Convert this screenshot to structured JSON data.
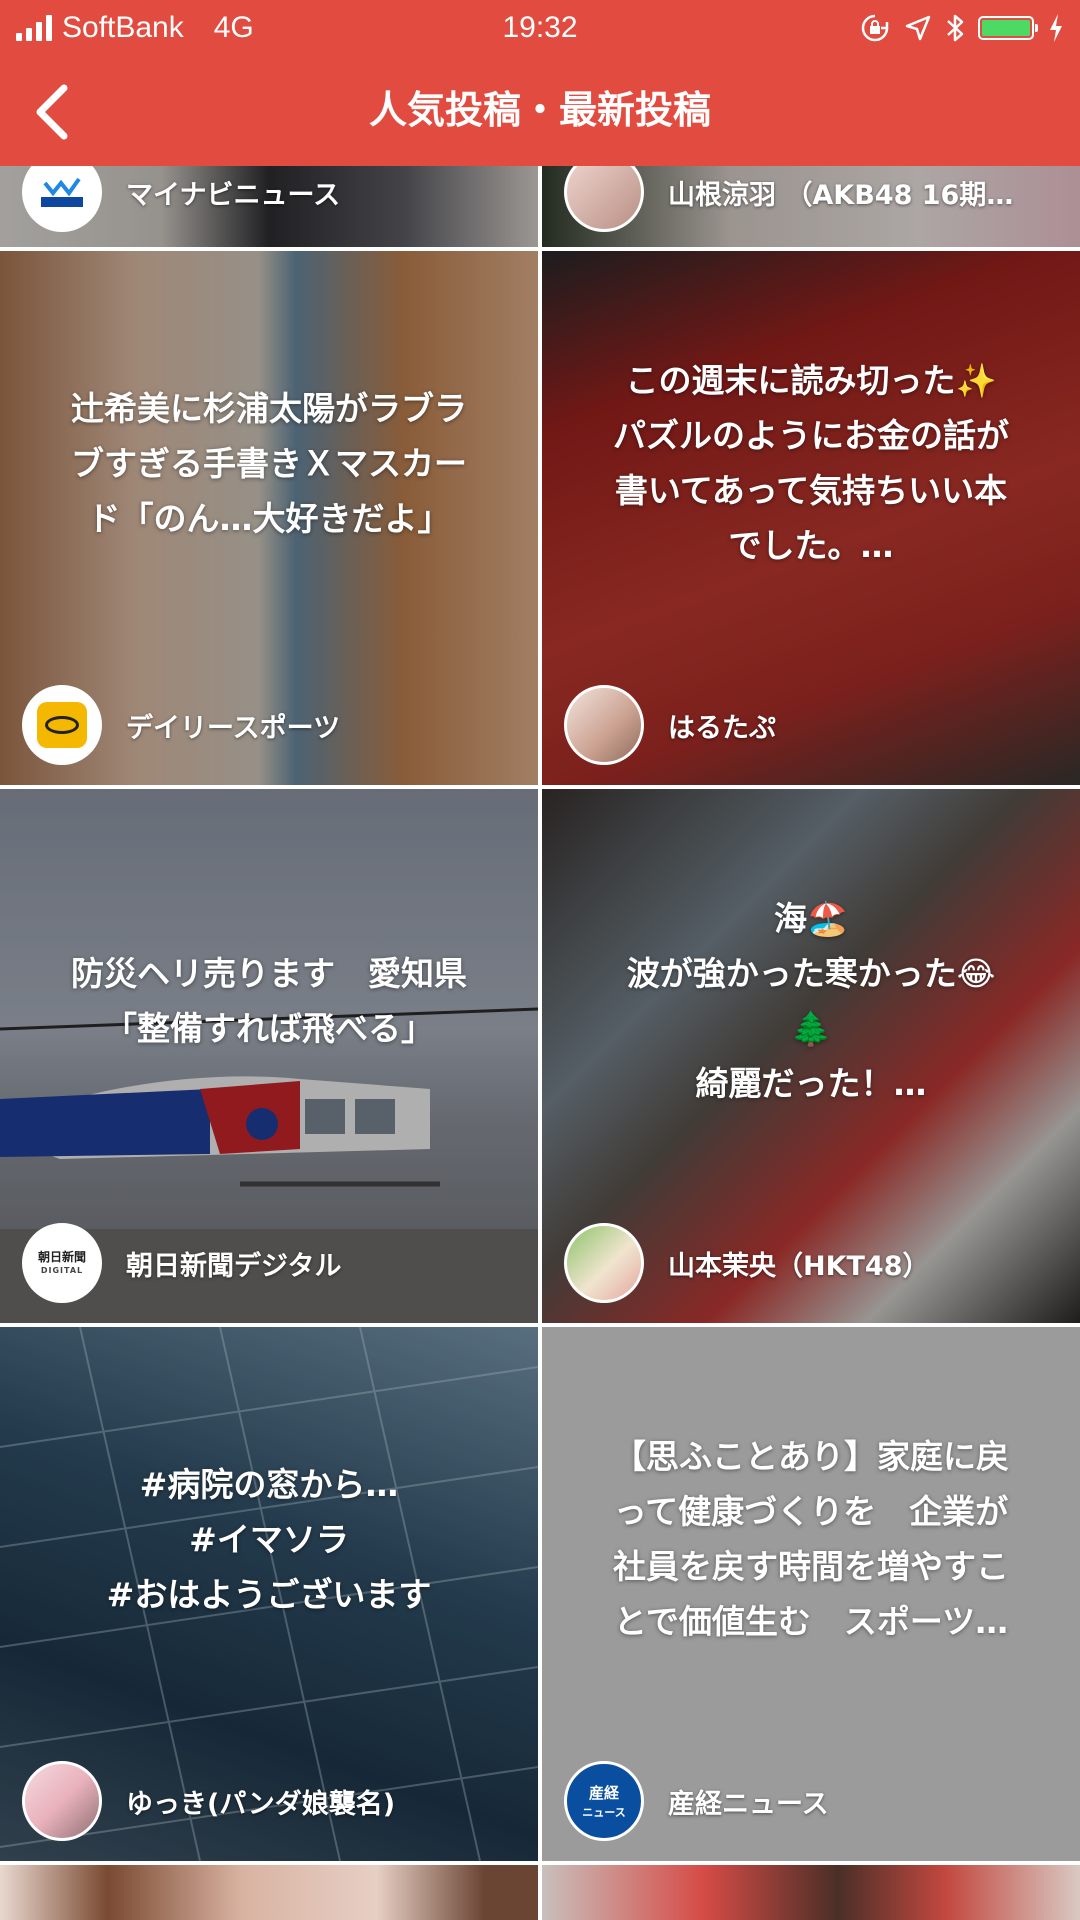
{
  "status": {
    "carrier": "SoftBank",
    "network": "4G",
    "time": "19:32",
    "battery_color": "#4cd964"
  },
  "header": {
    "title": "人気投稿・最新投稿",
    "back_icon": "chevron-left-icon",
    "background": "#e24b3f"
  },
  "top_partial": [
    {
      "author": "マイナビニュース"
    },
    {
      "author": "山根涼羽 （AKB48 16期…"
    }
  ],
  "posts": [
    {
      "text": "辻希美に杉浦太陽がラブラ\nブすぎる手書きＸマスカー\nド「のん…大好きだよ」",
      "author": "デイリースポーツ"
    },
    {
      "text": "この週末に読み切った✨\nパズルのようにお金の話が\n書いてあって気持ちいい本\nでした。…",
      "author": "はるたぷ"
    },
    {
      "text": "防災ヘリ売ります　愛知県\n「整備すれば飛べる」",
      "author": "朝日新聞デジタル",
      "logo_text": "朝日新聞",
      "logo_sub": "DIGITAL"
    },
    {
      "text": "海🏖️\n波が強かった寒かった😂\n🌲\n綺麗だった！…",
      "author": "山本茉央（HKT48）"
    },
    {
      "text": "#病院の窓から…\n#イマソラ\n#おはようございます",
      "author": "ゆっき(パンダ娘襲名)"
    },
    {
      "text": "【思ふことあり】家庭に戻\nって健康づくりを　企業が\n社員を戻す時間を増やすこ\nとで価値生む　スポーツ…",
      "author": "産経ニュース",
      "logo_text": "産経",
      "logo_sub": "ニュース"
    }
  ]
}
